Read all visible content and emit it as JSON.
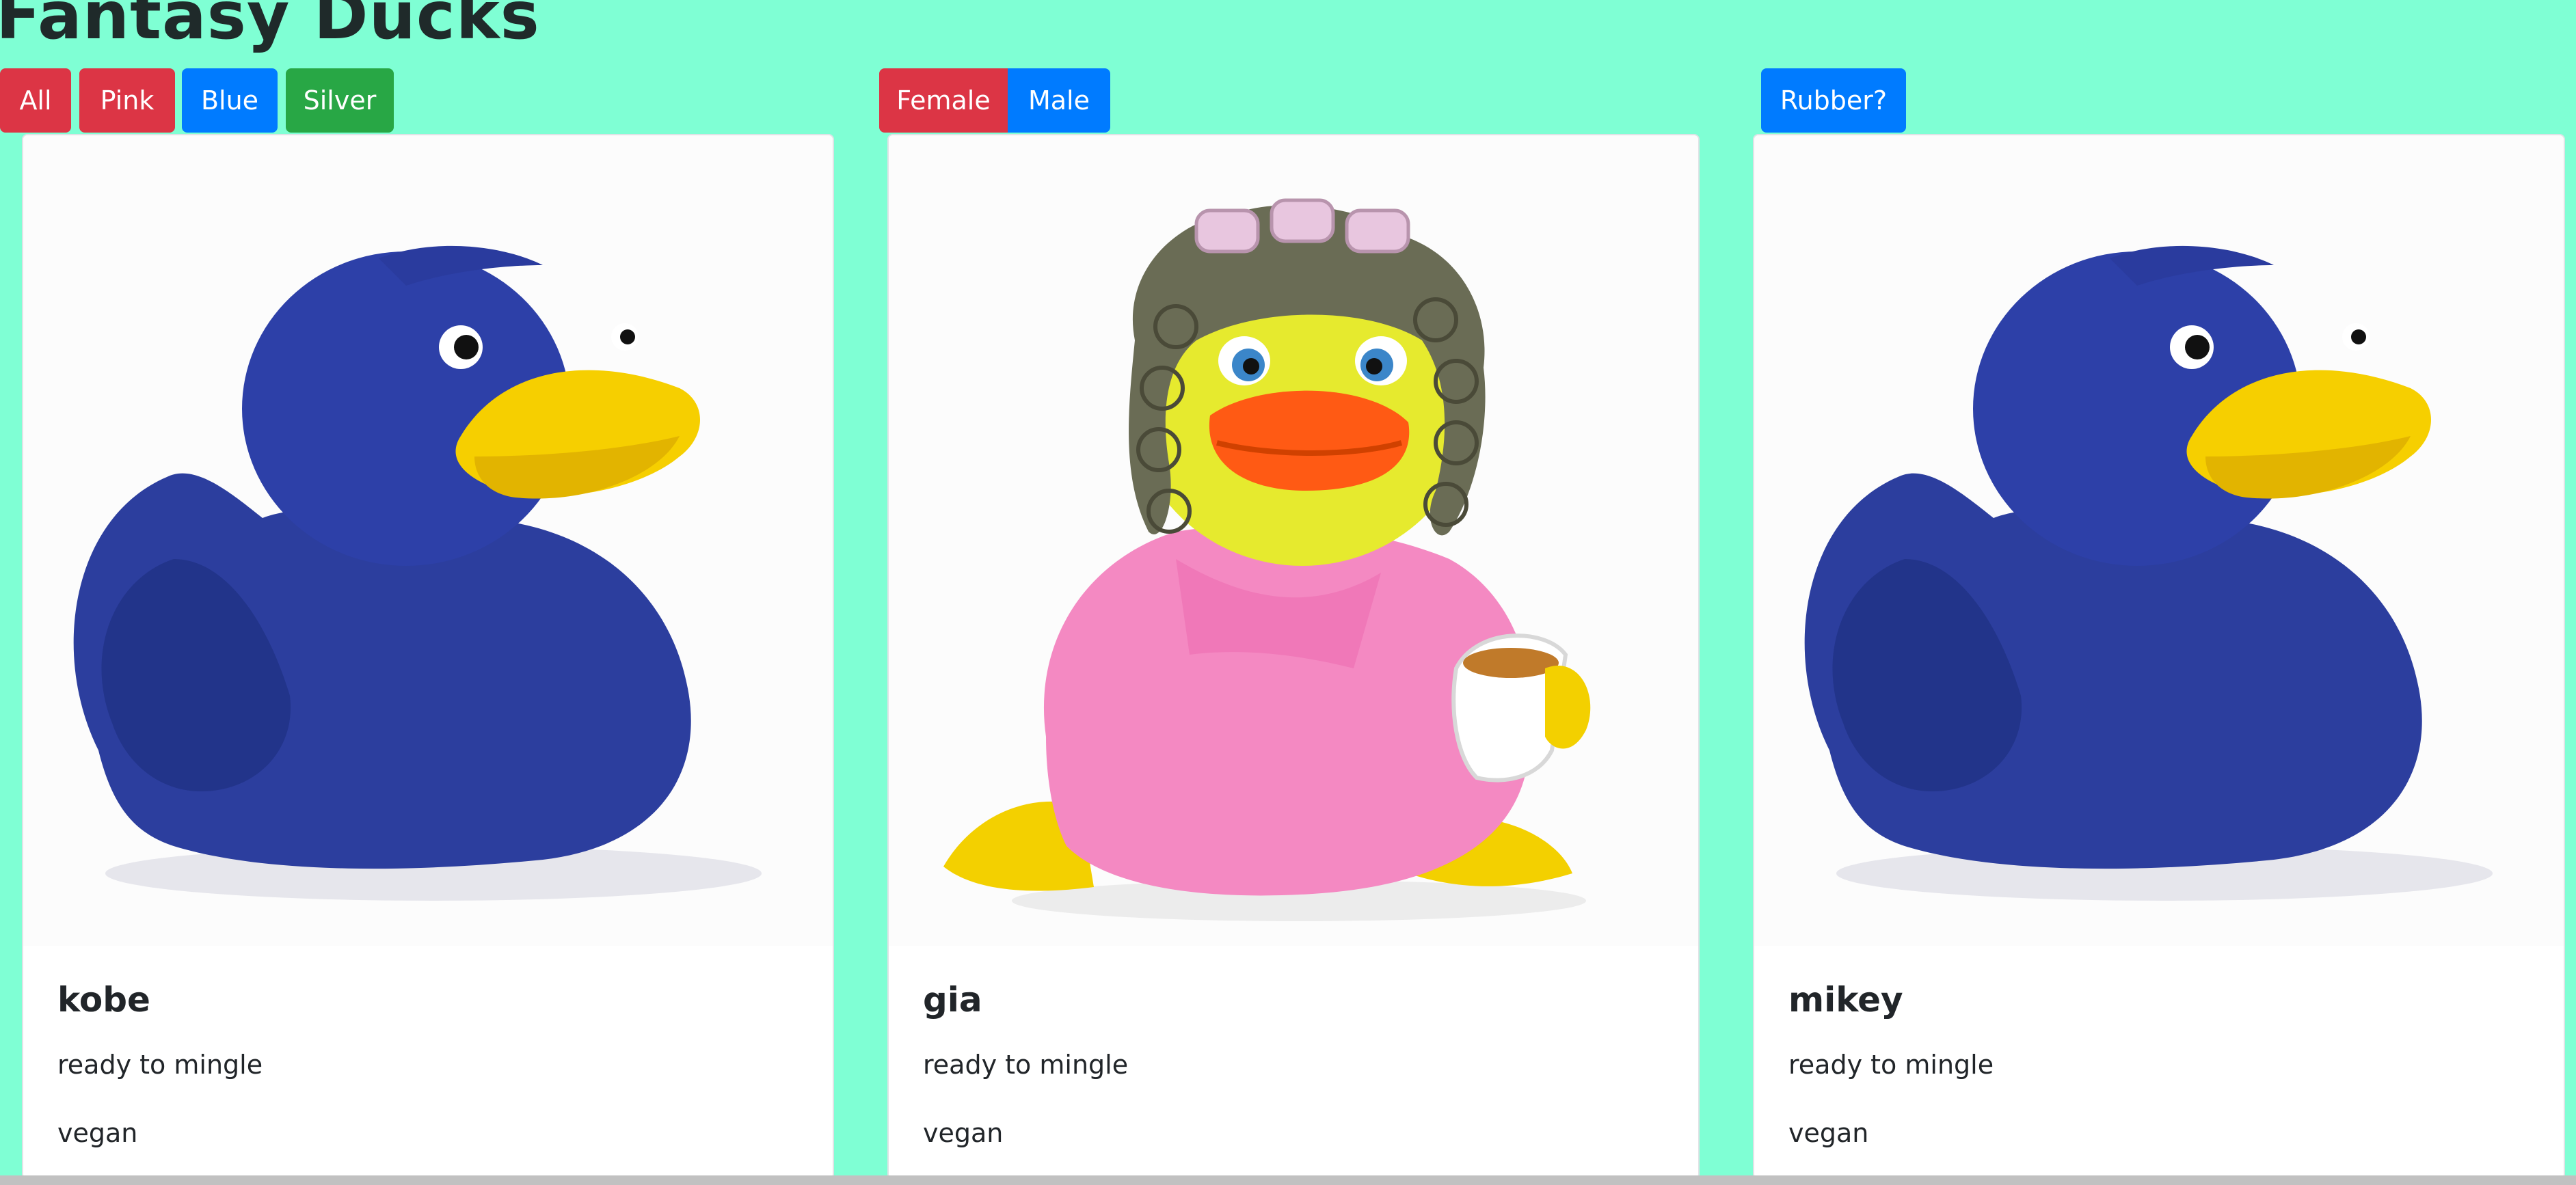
{
  "page_title": "Fantasy Ducks",
  "filters": {
    "color": [
      "All",
      "Pink",
      "Blue",
      "Silver"
    ],
    "gender": [
      "Female",
      "Male"
    ],
    "rubber": "Rubber?"
  },
  "cards": [
    {
      "name": "kobe",
      "status": "ready to mingle",
      "diet": "vegan",
      "image": "blue-rubber-duck"
    },
    {
      "name": "gia",
      "status": "ready to mingle",
      "diet": "vegan",
      "image": "pink-robe-duck-with-curlers"
    },
    {
      "name": "mikey",
      "status": "ready to mingle",
      "diet": "vegan",
      "image": "blue-rubber-duck"
    }
  ],
  "colors": {
    "background": "#7fffd4",
    "red": "#dc3545",
    "blue": "#007bff",
    "green": "#28a745"
  }
}
